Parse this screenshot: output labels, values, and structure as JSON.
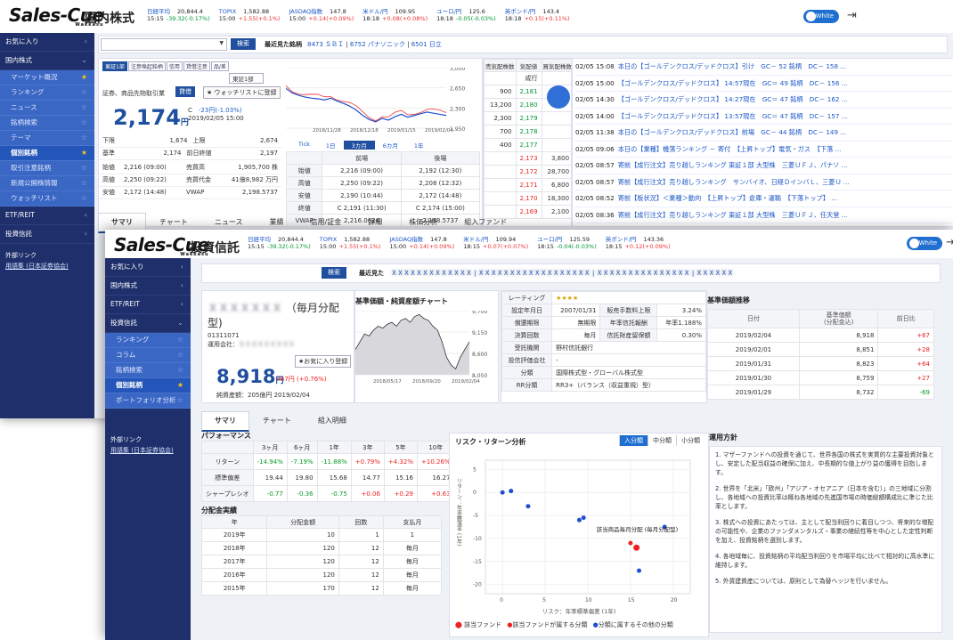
{
  "w1": {
    "logo": "Sales-Cue",
    "logo_sub": "Wakkasu",
    "title": "国内株式",
    "tickers": [
      {
        "name": "日経平均",
        "value": "20,844.4",
        "time": "15:15",
        "change": "-39.32(-0.17%)",
        "dir": "down"
      },
      {
        "name": "TOPIX",
        "value": "1,582.88",
        "time": "15:00",
        "change": "+1.55(+0.1%)",
        "dir": "up"
      },
      {
        "name": "JASDAQ指数",
        "value": "147.8",
        "time": "15:00",
        "change": "+0.14(+0.09%)",
        "dir": "up"
      },
      {
        "name": "米ドル/円",
        "value": "109.95",
        "time": "18:18",
        "change": "+0.08(+0.08%)",
        "dir": "up"
      },
      {
        "name": "ユーロ/円",
        "value": "125.6",
        "time": "18:18",
        "change": "-0.05(-0.03%)",
        "dir": "down"
      },
      {
        "name": "英ポンド/円",
        "value": "143.4",
        "time": "18:18",
        "change": "+0.15(+0.11%)",
        "dir": "up"
      }
    ],
    "toggle": "White",
    "sidebar": {
      "sections": [
        {
          "label": "お気に入り"
        },
        {
          "label": "国内株式"
        }
      ],
      "items": [
        {
          "label": "マーケット概況"
        },
        {
          "label": "ランキング"
        },
        {
          "label": "ニュース"
        },
        {
          "label": "銘柄検索"
        },
        {
          "label": "テーマ"
        },
        {
          "label": "個別銘柄"
        },
        {
          "label": "取引注意銘柄"
        },
        {
          "label": "新規公開株情報"
        },
        {
          "label": "ウォッチリスト"
        }
      ],
      "etf": "ETF/REIT",
      "fund": "投資信託",
      "link_title": "外部リンク",
      "link": "用語集 (日本証券協会)"
    },
    "search_btn": "検索",
    "recent_label": "最近見た銘柄",
    "recent_items": [
      "8473 ＳＢＩ",
      "6752 パナソニック",
      "6501 日立"
    ],
    "stock": {
      "tags": [
        "東証1部",
        "注意喚起銘柄",
        "信用",
        "貸借注意",
        "品/差"
      ],
      "market": "東証1部",
      "type_label": "証券、商品先物取引業",
      "trade_btn": "貸借",
      "watch_btn": "★ ウォッチリストに登録",
      "price": "2,174",
      "price_unit": "円",
      "change_prefix": "C",
      "change": "-23円(-1.03%)",
      "date": "2019/02/05 15:00",
      "stats": [
        {
          "label": "下限",
          "value": "1,674",
          "suffix": "上限",
          "value2": "2,674"
        },
        {
          "label": "基準",
          "value": "2,174",
          "suffix": "前日終値",
          "value2": "2,197"
        }
      ],
      "ohlc": [
        {
          "label": "始値",
          "value": "2,216 (09:00)",
          "label2": "売買高",
          "value2": "1,905,700 株"
        },
        {
          "label": "高値",
          "value": "2,250 (09:22)",
          "label2": "売買代金",
          "value2": "41億8,982 万円"
        },
        {
          "label": "安値",
          "value": "2,172 (14:48)",
          "label2": "VWAP",
          "value2": "2,198.5737"
        }
      ]
    },
    "chart": {
      "yticks": [
        "3,000",
        "2,650",
        "2,300",
        "1,950"
      ],
      "xticks": [
        "2018/11/28",
        "2018/12/18",
        "2019/01/15",
        "2019/02/04"
      ],
      "ranges": [
        "Tick",
        "1日",
        "3カ月",
        "6カ月",
        "1年"
      ],
      "active_range": "3カ月",
      "series": [
        2640,
        2560,
        2520,
        2490,
        2470,
        2460,
        2440,
        2470,
        2420,
        2380,
        2330,
        2260,
        2170,
        2100,
        2060,
        2120,
        2090,
        2150,
        2190,
        2140,
        2170,
        2200,
        2230,
        2210,
        2190,
        2170
      ]
    },
    "session": {
      "headers": [
        "",
        "前場",
        "後場"
      ],
      "rows": [
        [
          "始値",
          "2,216 (09:00)",
          "2,192 (12:30)"
        ],
        [
          "高値",
          "2,250 (09:22)",
          "2,208 (12:32)"
        ],
        [
          "安値",
          "2,190 (10:44)",
          "2,172 (14:48)"
        ],
        [
          "終値",
          "C 2,191 (11:30)",
          "C 2,174 (15:00)"
        ],
        [
          "VWAP",
          "2,216.0624",
          "2,198.5737"
        ]
      ]
    },
    "board": {
      "headers": [
        "売気配株数",
        "気配値",
        "買気配株数"
      ],
      "rows": [
        [
          "",
          "成行",
          ""
        ],
        [
          "900",
          "2,181",
          ""
        ],
        [
          "13,200",
          "2,180",
          ""
        ],
        [
          "2,300",
          "2,179",
          ""
        ],
        [
          "700",
          "2,178",
          ""
        ],
        [
          "400",
          "2,177",
          ""
        ],
        [
          "",
          "2,173",
          "3,800"
        ],
        [
          "",
          "2,172",
          "28,700"
        ],
        [
          "",
          "2,171",
          "6,800"
        ],
        [
          "",
          "2,170",
          "18,300"
        ],
        [
          "",
          "2,169",
          "2,100"
        ]
      ]
    },
    "news": [
      {
        "time": "02/05 15:08",
        "text": "本日の【ゴールデンクロス/デッドクロス】引け　GC－ 52 銘柄　DC－ 158 ..."
      },
      {
        "time": "02/05 15:00",
        "text": "【ゴールデンクロス/デッドクロス】 14:57現在　GC＝ 49 銘柄　DC－ 156 ..."
      },
      {
        "time": "02/05 14:30",
        "text": "【ゴールデンクロス/デッドクロス】 14:27現在　GC＝ 47 銘柄　DC－ 162 ..."
      },
      {
        "time": "02/05 14:00",
        "text": "【ゴールデンクロス/デッドクロス】 13:57現在　GC＝ 47 銘柄　DC－ 157 ..."
      },
      {
        "time": "02/05 11:38",
        "text": "本日の【ゴールデンクロス/デッドクロス】前場　GC－ 44 銘柄　DC－ 149 ..."
      },
      {
        "time": "02/05 09:06",
        "text": "本日の【業種】機落ランキング － 寄付　【上昇トップ】電気・ガス　【下落 ..."
      },
      {
        "time": "02/05 08:57",
        "text": "寄前【成行注文】売り越しランキング 東証１部 大型株　三菱ＵＦＪ、パナソ ..."
      },
      {
        "time": "02/05 08:57",
        "text": "寄前【成行注文】売り越しランキング　サンバイオ、日経ＤインバＬ、三菱Ｕ ..."
      },
      {
        "time": "02/05 08:52",
        "text": "寄前【板状況】＜業種＞動向　【上昇トップ】倉庫・運輸　【下落トップ】 ..."
      },
      {
        "time": "02/05 08:36",
        "text": "寄前【成行注文】売り越しランキング 東証１部 大型株　三菱ＵＦＪ、任天堂 ..."
      }
    ],
    "tabs": [
      "サマリ",
      "チャート",
      "ニュース",
      "業績",
      "信用/証金",
      "詳細",
      "株価分析",
      "組入ファンド"
    ]
  },
  "w2": {
    "logo": "Sales-Cue",
    "logo_sub": "Wakkasu",
    "title": "投資信託",
    "tickers": [
      {
        "name": "日経平均",
        "value": "20,844.4",
        "time": "15:15",
        "change": "-39.32(-0.17%)",
        "dir": "down"
      },
      {
        "name": "TOPIX",
        "value": "1,582.88",
        "time": "15:00",
        "change": "+1.55(+0.1%)",
        "dir": "up"
      },
      {
        "name": "JASDAQ指数",
        "value": "147.8",
        "time": "15:00",
        "change": "+0.14(+0.09%)",
        "dir": "up"
      },
      {
        "name": "米ドル/円",
        "value": "109.94",
        "time": "18:15",
        "change": "+0.07(+0.07%)",
        "dir": "up"
      },
      {
        "name": "ユーロ/円",
        "value": "125.59",
        "time": "18:15",
        "change": "-0.04(-0.03%)",
        "dir": "down"
      },
      {
        "name": "英ポンド/円",
        "value": "143.36",
        "time": "18:15",
        "change": "+0.12(+0.09%)",
        "dir": "up"
      }
    ],
    "toggle": "White",
    "sidebar": {
      "favorites": "お気に入り",
      "domestic": "国内株式",
      "etf": "ETF/REIT",
      "fund": "投資信託",
      "items": [
        {
          "label": "ランキング"
        },
        {
          "label": "コラム"
        },
        {
          "label": "銘柄検索"
        },
        {
          "label": "個別銘柄"
        },
        {
          "label": "ポートフォリオ分析"
        }
      ],
      "link_title": "外部リンク",
      "link": "用語集 (日本証券協会)"
    },
    "search_btn": "検索",
    "recent_label": "最近見た",
    "fund": {
      "name_suffix": "（毎月分配",
      "name_line2": "型)",
      "code": "01311071",
      "company_label": "運用会社：",
      "watch_btn": "★お気に入り登録",
      "price": "8,918",
      "price_unit": "円",
      "change": "+67円 (+0.76%)",
      "assets": "純資産額：205億円 2019/02/04"
    },
    "nav_chart": {
      "title": "基準価額・純資産額チャート",
      "yticks": [
        "9,700",
        "9,150",
        "8,600",
        "8,050"
      ],
      "xticks": [
        "2018/05/17",
        "2018/09/20",
        "2019/02/04"
      ],
      "series": [
        8700,
        8900,
        9100,
        9050,
        9200,
        9300,
        9250,
        9350,
        9400,
        9300,
        9450,
        9500,
        9400,
        9550,
        9600,
        9500,
        9450,
        9300,
        9200,
        8900,
        8500,
        8300,
        8200,
        8500,
        8700,
        8900
      ]
    },
    "rating": {
      "label": "レーティング",
      "stars": "★★★★",
      "rows": [
        [
          "設定年月日",
          "2007/01/31",
          "販売手数料上限",
          "3.24%"
        ],
        [
          "償還期限",
          "無期限",
          "年率信託報酬",
          "年率1.188%"
        ],
        [
          "決算回数",
          "毎月",
          "信託財産留保額",
          "0.30%"
        ]
      ],
      "rows2": [
        [
          "受託機関",
          "野村信託銀行"
        ],
        [
          "投信評価会社",
          "-"
        ],
        [
          "分類",
          "国際株式型・グローバル株式型"
        ],
        [
          "RR分類",
          "RR3+（バランス（収益重視）型）"
        ]
      ]
    },
    "history": {
      "title": "基準価額推移",
      "headers": [
        "日付",
        "基準価額\n(分配金込)",
        "前日比"
      ],
      "rows": [
        [
          "2019/02/04",
          "8,918",
          "+67"
        ],
        [
          "2019/02/01",
          "8,851",
          "+28"
        ],
        [
          "2019/01/31",
          "8,823",
          "+64"
        ],
        [
          "2019/01/30",
          "8,759",
          "+27"
        ],
        [
          "2019/01/29",
          "8,732",
          "-69"
        ]
      ]
    },
    "tabs": [
      "サマリ",
      "チャート",
      "組入明細"
    ],
    "performance": {
      "title": "パフォーマンス",
      "headers": [
        "",
        "3ヶ月",
        "6ヶ月",
        "1年",
        "3年",
        "5年",
        "10年"
      ],
      "rows": [
        [
          "リターン",
          "-14.94%",
          "-7.19%",
          "-11.88%",
          "+0.79%",
          "+4.32%",
          "+10.26%"
        ],
        [
          "標準偏差",
          "19.44",
          "19.80",
          "15.68",
          "14.77",
          "15.16",
          "16.27"
        ],
        [
          "シャープレシオ",
          "-0.77",
          "-0.36",
          "-0.75",
          "+0.06",
          "+0.29",
          "+0.63"
        ]
      ]
    },
    "dividend": {
      "title": "分配金実績",
      "headers": [
        "年",
        "分配金額",
        "回数",
        "支払月"
      ],
      "rows": [
        [
          "2019年",
          "10",
          "1",
          "1"
        ],
        [
          "2018年",
          "120",
          "12",
          "毎月"
        ],
        [
          "2017年",
          "120",
          "12",
          "毎月"
        ],
        [
          "2016年",
          "120",
          "12",
          "毎月"
        ],
        [
          "2015年",
          "170",
          "12",
          "毎月"
        ]
      ]
    },
    "risk": {
      "title": "リスク・リターン分析",
      "filters": [
        "入分類",
        "中分類",
        "小分類"
      ],
      "active_filter": "入分類",
      "xlabel": "リスク：年率標準偏差 (1年)",
      "ylabel": "リターン：年率騰落率 (1年)",
      "xticks": [
        "0",
        "5",
        "10",
        "15",
        "20"
      ],
      "yticks": [
        "5",
        "0",
        "-5",
        "-10",
        "-15",
        "-20"
      ],
      "annotation": "該当商品毎月分配 (毎月分配型)",
      "legend": [
        "該当ファンド",
        "該当ファンドが属する分類",
        "分類に属するその他の分類"
      ],
      "chart_data": {
        "type": "scatter",
        "xlim": [
          -2,
          22
        ],
        "ylim": [
          -22,
          7
        ],
        "series": [
          {
            "name": "分類に属するその他の分類",
            "points": [
              [
                0,
                0
              ],
              [
                1,
                0.3
              ],
              [
                3,
                -3
              ],
              [
                9,
                -6
              ],
              [
                9.5,
                -5.5
              ],
              [
                19,
                -7.5
              ],
              [
                16,
                -17
              ]
            ]
          },
          {
            "name": "該当ファンドが属する分類",
            "points": [
              [
                15,
                -11
              ]
            ]
          },
          {
            "name": "該当ファンド",
            "points": [
              [
                15.7,
                -12
              ]
            ]
          }
        ]
      }
    },
    "policy": {
      "title": "運用方針",
      "paras": [
        "1. マザーファンドへの投資を通じて、世界各国の株式を実質的な主要投資対象とし、安定した配当収益の確保に加え、中長期的な値上がり益の獲得を目指します。",
        "2. 世界を「北米」「欧州」「アジア・オセアニア（日本を含む）」の三地域に分割し、各地域への投資比率は概ね各地域の先進国市場の時価総額構成比に準じた比率とします。",
        "3. 株式への投資にあたっては、主として配当利回りに着目しつつ、将来的な増配の可能性や、企業のファンダメンタルズ・事業の継続性等を中心とした定性判断を加え、投資銘柄を選別します。",
        "4. 各地域毎に、投資銘柄の平均配当利回りを市場平均に比べて相対的に高水準に維持します。",
        "5. 外貨建資産については、原則として為替ヘッジを行いません。"
      ]
    }
  }
}
